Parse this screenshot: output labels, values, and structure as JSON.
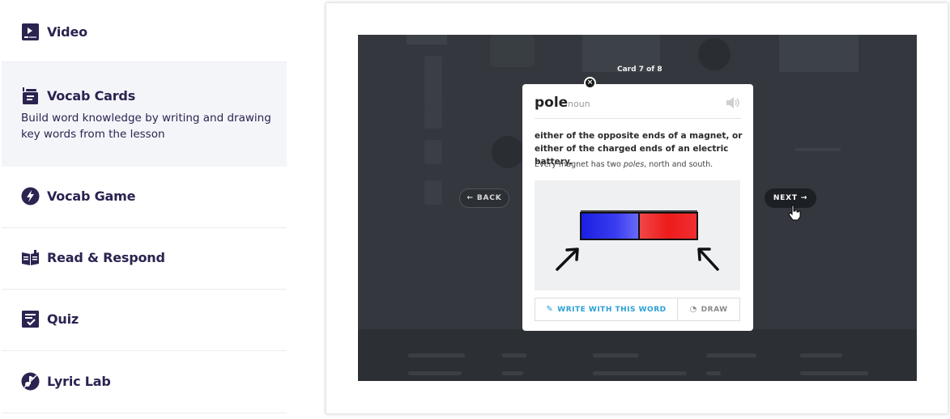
{
  "sidebar": {
    "items": [
      {
        "label": "Video",
        "icon": "video-icon"
      },
      {
        "label": "Vocab Cards",
        "icon": "vocab-cards-icon",
        "description": "Build word knowledge by writing and drawing key words from the lesson",
        "active": true
      },
      {
        "label": "Vocab Game",
        "icon": "lightning-icon"
      },
      {
        "label": "Read & Respond",
        "icon": "open-book-icon"
      },
      {
        "label": "Quiz",
        "icon": "quiz-checklist-icon"
      },
      {
        "label": "Lyric Lab",
        "icon": "lyric-lab-icon"
      }
    ]
  },
  "video": {
    "counter": "Card 7 of 8",
    "back_label": "BACK",
    "next_label": "NEXT"
  },
  "card": {
    "word": "pole",
    "part_of_speech": "noun",
    "definition": "either of the opposite ends of a magnet, or either of the charged ends of an electric battery.",
    "example_before": "Every magnet has two ",
    "example_em": "poles",
    "example_after": ", north and south.",
    "write_label": "WRITE WITH THIS WORD",
    "draw_label": "DRAW"
  },
  "colors": {
    "brand": "#2b2350",
    "accent": "#2a9fd6",
    "magnet_north": "#1a1ee0",
    "magnet_south": "#ee1b1b"
  }
}
